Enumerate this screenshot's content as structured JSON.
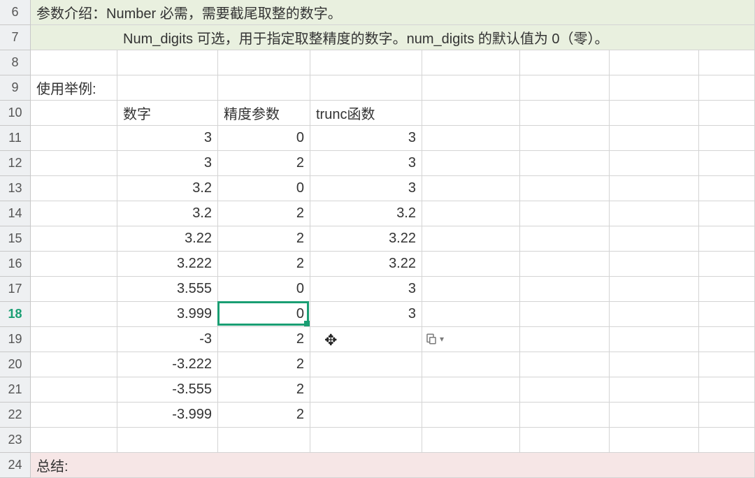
{
  "rowStart": 6,
  "rowEnd": 24,
  "activeRow": 18,
  "selection": {
    "row": 18,
    "col": 3
  },
  "cursor": {
    "row": 19,
    "col": 4,
    "glyph": "✥"
  },
  "pasteIcon": {
    "row": 19,
    "col": 5
  },
  "intro": {
    "prefix": "参数介绍：",
    "line1": "Number 必需，需要截尾取整的数字。",
    "line2": "Num_digits 可选，用于指定取整精度的数字。num_digits 的默认值为 0（零）。"
  },
  "labels": {
    "example": "使用举例:",
    "col_num": "数字",
    "col_prec": "精度参数",
    "col_trunc": "trunc函数",
    "summary": "总结:"
  },
  "rows": [
    {
      "num": "3",
      "prec": "0",
      "trunc": "3"
    },
    {
      "num": "3",
      "prec": "2",
      "trunc": "3"
    },
    {
      "num": "3.2",
      "prec": "0",
      "trunc": "3"
    },
    {
      "num": "3.2",
      "prec": "2",
      "trunc": "3.2"
    },
    {
      "num": "3.22",
      "prec": "2",
      "trunc": "3.22"
    },
    {
      "num": "3.222",
      "prec": "2",
      "trunc": "3.22"
    },
    {
      "num": "3.555",
      "prec": "0",
      "trunc": "3"
    },
    {
      "num": "3.999",
      "prec": "0",
      "trunc": "3"
    },
    {
      "num": "-3",
      "prec": "2",
      "trunc": ""
    },
    {
      "num": "-3.222",
      "prec": "2",
      "trunc": ""
    },
    {
      "num": "-3.555",
      "prec": "2",
      "trunc": ""
    },
    {
      "num": "-3.999",
      "prec": "2",
      "trunc": ""
    }
  ]
}
